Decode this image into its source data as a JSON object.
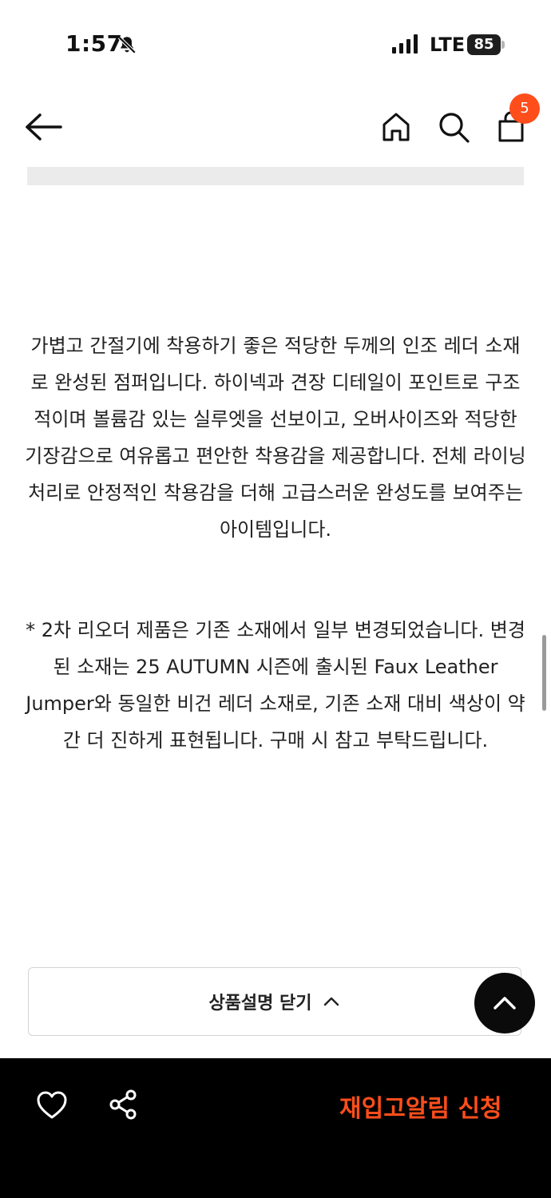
{
  "status_bar": {
    "time": "1:57",
    "network": "LTE",
    "battery": "85"
  },
  "header": {
    "cart_count": "5",
    "icons": [
      "arrow-left-icon",
      "home-icon",
      "search-icon",
      "shopping-bag-icon"
    ]
  },
  "description": {
    "paragraph_1": "가볍고 간절기에 착용하기 좋은 적당한 두께의 인조 레더 소재로 완성된 점퍼입니다. 하이넥과 견장 디테일이 포인트로 구조적이며 볼륨감 있는 실루엣을 선보이고, 오버사이즈와 적당한 기장감으로 여유롭고 편안한 착용감을 제공합니다. 전체 라이닝 처리로 안정적인 착용감을 더해 고급스러운 완성도를 보여주는 아이템입니다.",
    "paragraph_2": "* 2차 리오더 제품은 기존 소재에서 일부 변경되었습니다. 변경된 소재는 25 AUTUMN 시즌에 출시된 Faux Leather Jumper와 동일한 비건 레더 소재로, 기존 소재 대비 색상이 약간 더 진하게 표현됩니다. 구매 시 참고 부탁드립니다."
  },
  "close_button": {
    "label": "상품설명 닫기"
  },
  "bottom_bar": {
    "restock_label": "재입고알림 신청"
  },
  "colors": {
    "accent": "#ff4e1b",
    "bottom_bar_bg": "#000000"
  }
}
